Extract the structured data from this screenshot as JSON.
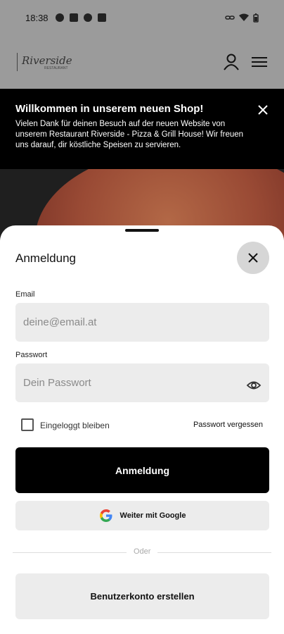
{
  "status_bar": {
    "time": "18:38"
  },
  "header": {
    "logo_text": "Riverside",
    "logo_sub": "RESTAURANT"
  },
  "banner": {
    "title": "Willkommen in unserem neuen Shop!",
    "text": "Vielen Dank für deinen Besuch auf der neuen Website von unserem Restaurant Riverside - Pizza & Grill House! Wir freuen uns darauf, dir köstliche Speisen zu servieren."
  },
  "sheet": {
    "title": "Anmeldung",
    "email_label": "Email",
    "email_placeholder": "deine@email.at",
    "email_value": "",
    "password_label": "Passwort",
    "password_placeholder": "Dein Passwort",
    "password_value": "",
    "remember_label": "Eingeloggt bleiben",
    "remember_checked": false,
    "forgot_label": "Passwort vergessen",
    "login_button": "Anmeldung",
    "google_button": "Weiter mit Google",
    "divider_text": "Oder",
    "create_button": "Benutzerkonto erstellen"
  },
  "icons": {
    "header": [
      "user-icon",
      "menu-icon"
    ],
    "banner": "close-icon",
    "sheet": [
      "close-icon",
      "eye-icon",
      "google-icon"
    ]
  },
  "colors": {
    "primary_button": "#000000",
    "secondary_button": "#ececec",
    "overlay": "#9b9b9b"
  }
}
